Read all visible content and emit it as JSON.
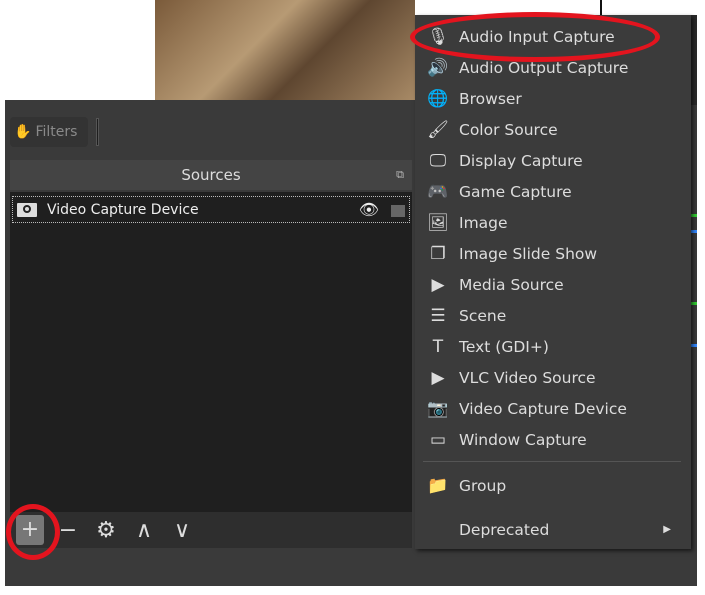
{
  "filters_label": "Filters",
  "sources": {
    "title": "Sources",
    "items": [
      {
        "label": "Video Capture Device",
        "visible": true,
        "locked": false
      }
    ]
  },
  "toolbar": {
    "add": "+",
    "remove": "−",
    "settings": "⚙",
    "up": "∧",
    "down": "∨"
  },
  "menu": {
    "items": [
      {
        "label": "Audio Input Capture",
        "icon": "🎙"
      },
      {
        "label": "Audio Output Capture",
        "icon": "🔊"
      },
      {
        "label": "Browser",
        "icon": "🌐"
      },
      {
        "label": "Color Source",
        "icon": "🖌"
      },
      {
        "label": "Display Capture",
        "icon": "🖵"
      },
      {
        "label": "Game Capture",
        "icon": "🎮"
      },
      {
        "label": "Image",
        "icon": "🖼"
      },
      {
        "label": "Image Slide Show",
        "icon": "❐"
      },
      {
        "label": "Media Source",
        "icon": "▶"
      },
      {
        "label": "Scene",
        "icon": "☰"
      },
      {
        "label": "Text (GDI+)",
        "icon": "T"
      },
      {
        "label": "VLC Video Source",
        "icon": "▶"
      },
      {
        "label": "Video Capture Device",
        "icon": "📷"
      },
      {
        "label": "Window Capture",
        "icon": "▭"
      }
    ],
    "group": {
      "label": "Group",
      "icon": "📁"
    },
    "deprecated": {
      "label": "Deprecated",
      "arrow": "▶"
    }
  },
  "highlight_color": "#e3141e"
}
